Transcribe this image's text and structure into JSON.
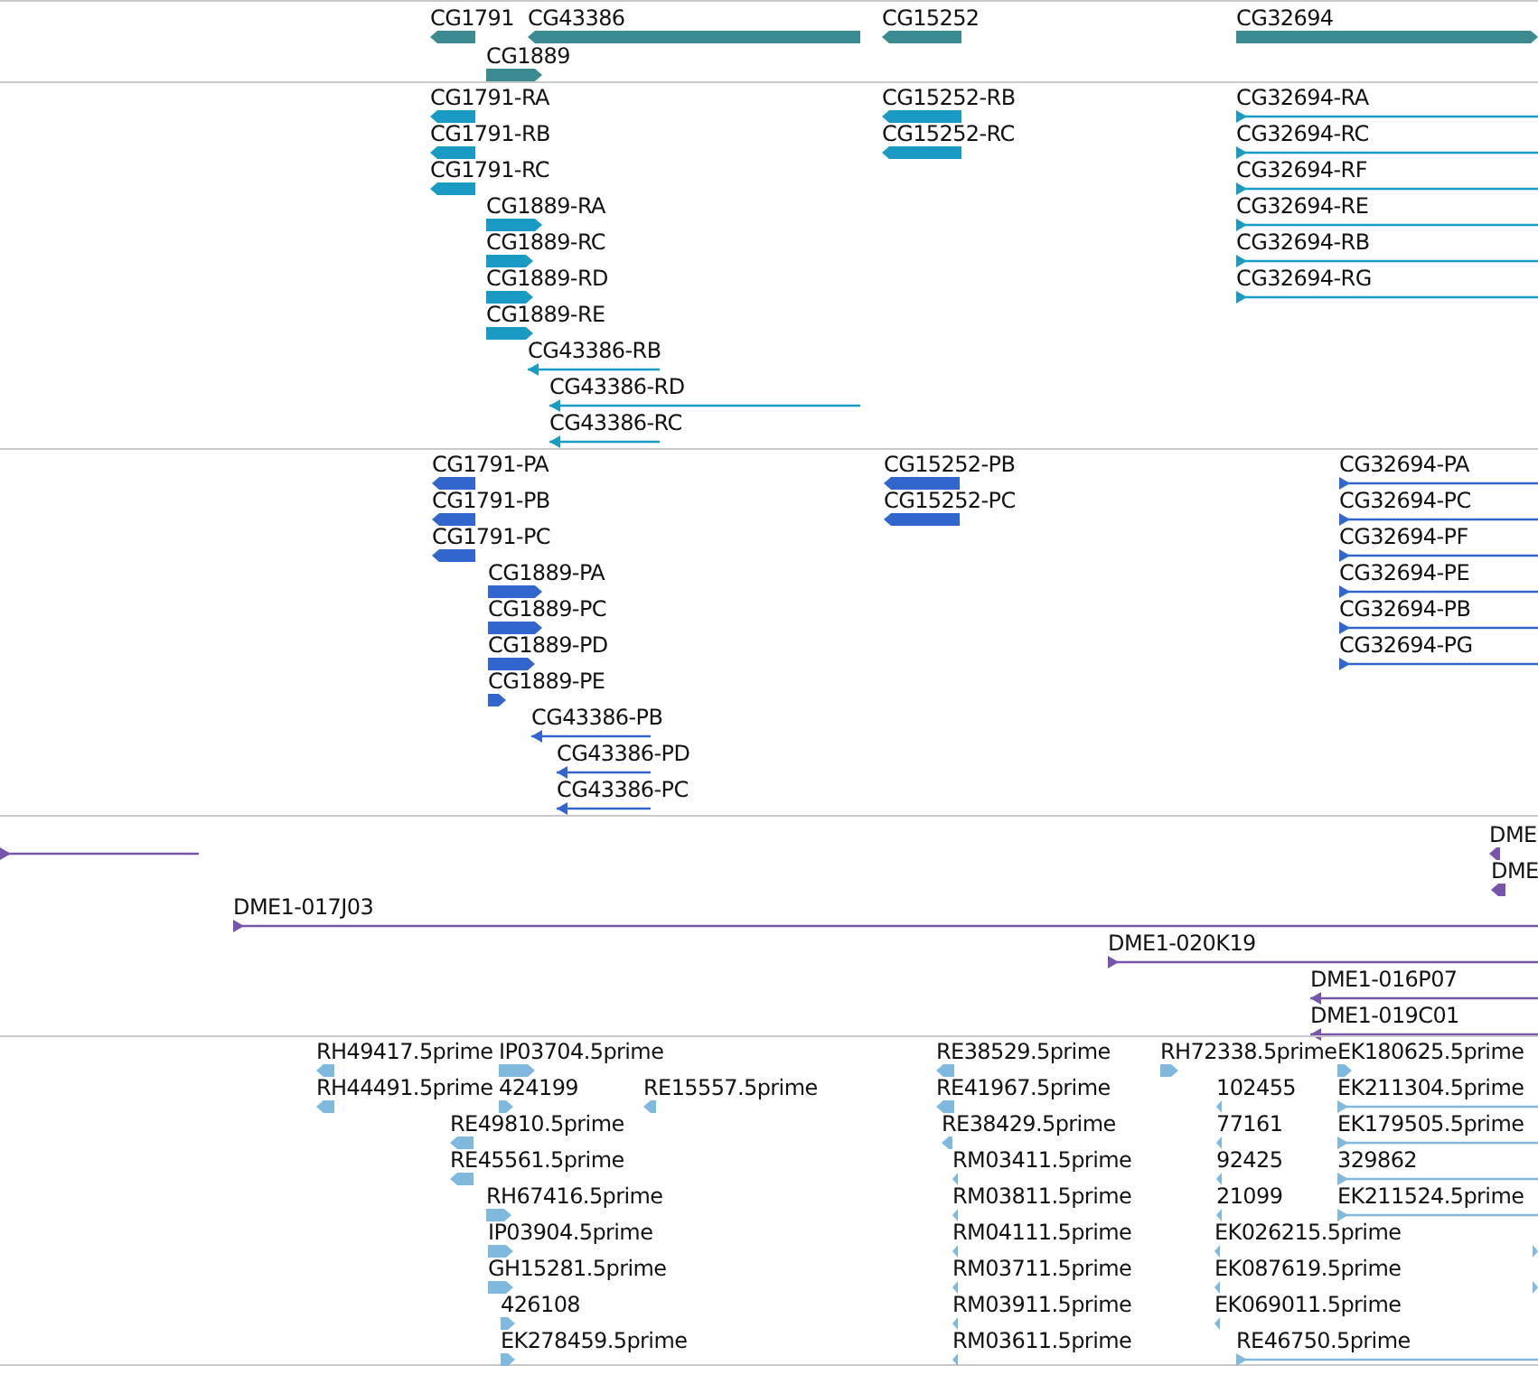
{
  "tracks": [
    {
      "color": "#3b8b90",
      "features": [
        {
          "label": "CG1791",
          "reverse": true
        },
        {
          "label": "CG43386",
          "reverse": true
        },
        {
          "label": "CG1889",
          "reverse": false
        },
        {
          "label": "CG15252",
          "reverse": true
        },
        {
          "label": "CG32694",
          "reverse": false
        }
      ]
    },
    {
      "color": "#1a9bc3",
      "features": [
        {
          "label": "CG1791-RA",
          "reverse": true
        },
        {
          "label": "CG1791-RB",
          "reverse": true
        },
        {
          "label": "CG1791-RC",
          "reverse": true
        },
        {
          "label": "CG1889-RA",
          "reverse": false
        },
        {
          "label": "CG1889-RC",
          "reverse": false
        },
        {
          "label": "CG1889-RD",
          "reverse": false
        },
        {
          "label": "CG1889-RE",
          "reverse": false
        },
        {
          "label": "CG43386-RB",
          "reverse": true
        },
        {
          "label": "CG43386-RD",
          "reverse": true
        },
        {
          "label": "CG43386-RC",
          "reverse": true
        },
        {
          "label": "CG15252-RB",
          "reverse": true
        },
        {
          "label": "CG15252-RC",
          "reverse": true
        },
        {
          "label": "CG32694-RA",
          "reverse": false
        },
        {
          "label": "CG32694-RC",
          "reverse": false
        },
        {
          "label": "CG32694-RF",
          "reverse": false
        },
        {
          "label": "CG32694-RE",
          "reverse": false
        },
        {
          "label": "CG32694-RB",
          "reverse": false
        },
        {
          "label": "CG32694-RG",
          "reverse": false
        }
      ]
    },
    {
      "color": "#3366cc",
      "features": [
        {
          "label": "CG1791-PA",
          "reverse": true
        },
        {
          "label": "CG1791-PB",
          "reverse": true
        },
        {
          "label": "CG1791-PC",
          "reverse": true
        },
        {
          "label": "CG1889-PA",
          "reverse": false
        },
        {
          "label": "CG1889-PC",
          "reverse": false
        },
        {
          "label": "CG1889-PD",
          "reverse": false
        },
        {
          "label": "CG1889-PE",
          "reverse": false
        },
        {
          "label": "CG43386-PB",
          "reverse": true
        },
        {
          "label": "CG43386-PD",
          "reverse": true
        },
        {
          "label": "CG43386-PC",
          "reverse": true
        },
        {
          "label": "CG15252-PB",
          "reverse": true
        },
        {
          "label": "CG15252-PC",
          "reverse": true
        },
        {
          "label": "CG32694-PA",
          "reverse": false
        },
        {
          "label": "CG32694-PC",
          "reverse": false
        },
        {
          "label": "CG32694-PF",
          "reverse": false
        },
        {
          "label": "CG32694-PE",
          "reverse": false
        },
        {
          "label": "CG32694-PB",
          "reverse": false
        },
        {
          "label": "CG32694-PG",
          "reverse": false
        }
      ]
    },
    {
      "color": "#7755aa",
      "features": [
        {
          "reverse": false
        },
        {
          "label": "DME",
          "reverse": true
        },
        {
          "label": "DME",
          "reverse": true
        },
        {
          "label": "DME1-017J03",
          "reverse": false
        },
        {
          "label": "DME1-020K19",
          "reverse": false
        },
        {
          "label": "DME1-016P07",
          "reverse": true
        },
        {
          "label": "DME1-019C01",
          "reverse": true
        }
      ]
    },
    {
      "color": "#80b9de",
      "features": [
        {
          "label": "RH49417.5prime",
          "reverse": true
        },
        {
          "label": "IP03704.5prime",
          "reverse": false
        },
        {
          "label": "RH44491.5prime",
          "reverse": true
        },
        {
          "label": "424199",
          "reverse": false
        },
        {
          "label": "RE15557.5prime",
          "reverse": true
        },
        {
          "label": "RE49810.5prime",
          "reverse": true
        },
        {
          "label": "RE45561.5prime",
          "reverse": true
        },
        {
          "label": "RH67416.5prime",
          "reverse": false
        },
        {
          "label": "IP03904.5prime",
          "reverse": false
        },
        {
          "label": "GH15281.5prime",
          "reverse": false
        },
        {
          "label": "426108",
          "reverse": false
        },
        {
          "label": "EK278459.5prime",
          "reverse": false
        },
        {
          "label": "RE38529.5prime",
          "reverse": true
        },
        {
          "label": "RE41967.5prime",
          "reverse": true
        },
        {
          "label": "RE38429.5prime",
          "reverse": true
        },
        {
          "label": "RM03411.5prime",
          "reverse": true
        },
        {
          "label": "RM03811.5prime",
          "reverse": true
        },
        {
          "label": "RM04111.5prime",
          "reverse": true
        },
        {
          "label": "RM03711.5prime",
          "reverse": true
        },
        {
          "label": "RM03911.5prime",
          "reverse": true
        },
        {
          "label": "RM03611.5prime",
          "reverse": true
        },
        {
          "label": "RH72338.5prime",
          "reverse": false
        },
        {
          "label": "EK180625.5prime",
          "reverse": false
        },
        {
          "label": "102455",
          "reverse": true
        },
        {
          "label": "77161",
          "reverse": true
        },
        {
          "label": "92425",
          "reverse": true
        },
        {
          "label": "21099",
          "reverse": true
        },
        {
          "label": "EK026215.5prime",
          "reverse": true
        },
        {
          "label": "EK087619.5prime",
          "reverse": true
        },
        {
          "label": "EK069011.5prime",
          "reverse": true
        },
        {
          "label": "RE46750.5prime",
          "reverse": false
        },
        {
          "label": "EK211304.5prime",
          "reverse": false
        },
        {
          "label": "EK179505.5prime",
          "reverse": false
        },
        {
          "label": "329862",
          "reverse": false
        },
        {
          "label": "EK211524.5prime",
          "reverse": false
        },
        {
          "reverse": false
        },
        {
          "reverse": false
        }
      ]
    }
  ]
}
